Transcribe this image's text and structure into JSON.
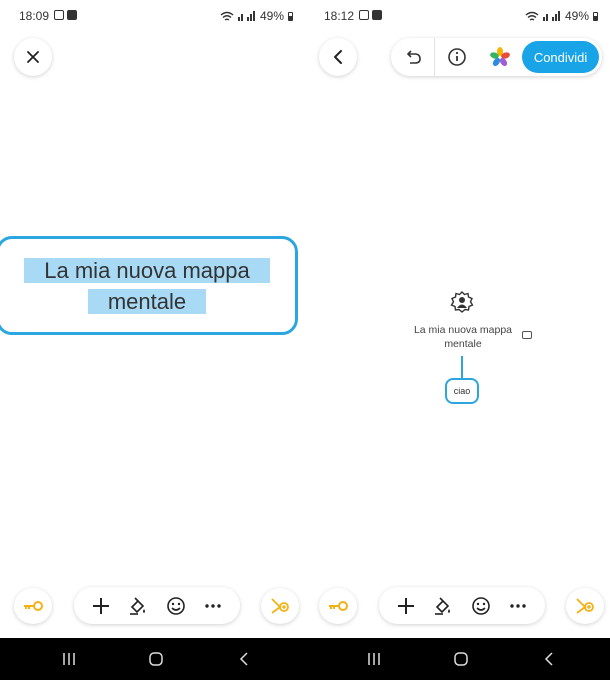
{
  "left_screen": {
    "status": {
      "time": "18:09",
      "battery": "49%"
    },
    "edit_node": {
      "line1": "La mia nuova mappa",
      "line2": "mentale"
    }
  },
  "right_screen": {
    "status": {
      "time": "18:12",
      "battery": "49%"
    },
    "toolbar": {
      "share_label": "Condividi"
    },
    "mindmap": {
      "root_line1": "La mia nuova mappa",
      "root_line2": "mentale",
      "child_label": "ciao"
    }
  },
  "icons": {
    "close": "close-icon",
    "back": "chevron-left-icon",
    "undo": "undo-icon",
    "info": "info-icon",
    "theme": "color-palette-icon",
    "key": "key-icon",
    "connect": "connect-icon",
    "add": "plus-icon",
    "style": "paint-bucket-icon",
    "emoji": "emoji-icon",
    "more": "more-icon"
  },
  "colors": {
    "accent": "#2ba6df",
    "share_button": "#1aa4e8",
    "selection": "#a9daf5",
    "key_yellow": "#f2b215"
  }
}
